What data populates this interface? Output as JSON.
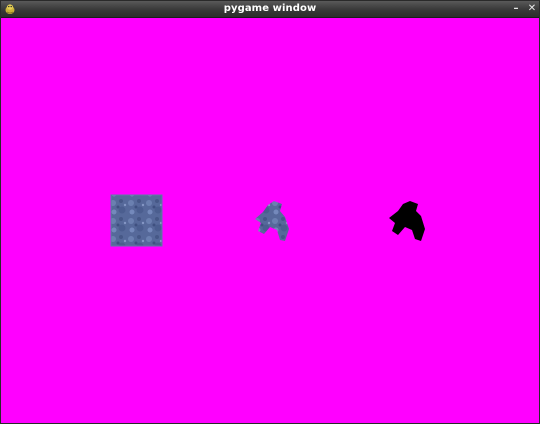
{
  "window": {
    "title": "pygame window",
    "minimize_label": "–",
    "close_label": "✕",
    "icon": "pygame-snake-icon"
  },
  "canvas": {
    "background_color": "#ff00ff"
  },
  "sprites": [
    {
      "name": "textured-square-sprite",
      "icon": "stone-tile",
      "color": "#5a6fa0"
    },
    {
      "name": "textured-arrow-sprite",
      "icon": "stone-cursor",
      "color": "#5a6fa0"
    },
    {
      "name": "black-arrow-sprite",
      "icon": "black-cursor-silhouette",
      "color": "#000000"
    }
  ]
}
